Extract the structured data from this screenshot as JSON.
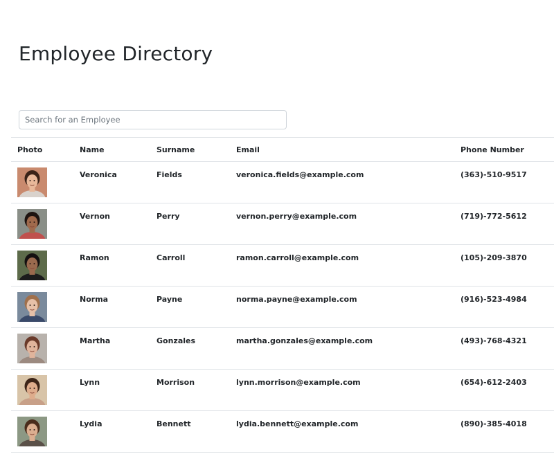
{
  "page": {
    "title": "Employee Directory"
  },
  "search": {
    "placeholder": "Search for an Employee",
    "value": ""
  },
  "table": {
    "headers": {
      "photo": "Photo",
      "name": "Name",
      "surname": "Surname",
      "email": "Email",
      "phone": "Phone Number"
    },
    "rows": [
      {
        "name": "Veronica",
        "surname": "Fields",
        "email": "veronica.fields@example.com",
        "phone": "(363)-510-9517",
        "photo": {
          "bg": "#c98a6e",
          "skin": "#e8b89a",
          "hair": "#3a2218",
          "shirt": "#d9d2cc"
        }
      },
      {
        "name": "Vernon",
        "surname": "Perry",
        "email": "vernon.perry@example.com",
        "phone": "(719)-772-5612",
        "photo": {
          "bg": "#8a8f88",
          "skin": "#a06a4c",
          "hair": "#1e1410",
          "shirt": "#c0504d"
        }
      },
      {
        "name": "Ramon",
        "surname": "Carroll",
        "email": "ramon.carroll@example.com",
        "phone": "(105)-209-3870",
        "photo": {
          "bg": "#5d6b4a",
          "skin": "#9a6a4e",
          "hair": "#141010",
          "shirt": "#1c1c1c"
        }
      },
      {
        "name": "Norma",
        "surname": "Payne",
        "email": "norma.payne@example.com",
        "phone": "(916)-523-4984",
        "photo": {
          "bg": "#7a8a9c",
          "skin": "#e6c0a8",
          "hair": "#a0704c",
          "shirt": "#3a4a6a"
        }
      },
      {
        "name": "Martha",
        "surname": "Gonzales",
        "email": "martha.gonzales@example.com",
        "phone": "(493)-768-4321",
        "photo": {
          "bg": "#b8b2ac",
          "skin": "#e0b49c",
          "hair": "#6a3a2a",
          "shirt": "#9c8a80"
        }
      },
      {
        "name": "Lynn",
        "surname": "Morrison",
        "email": "lynn.morrison@example.com",
        "phone": "(654)-612-2403",
        "photo": {
          "bg": "#d8c4a8",
          "skin": "#deac8c",
          "hair": "#3c2418",
          "shirt": "#c8a088"
        }
      },
      {
        "name": "Lydia",
        "surname": "Bennett",
        "email": "lydia.bennett@example.com",
        "phone": "(890)-385-4018",
        "photo": {
          "bg": "#8c9884",
          "skin": "#dcae90",
          "hair": "#4a2c1c",
          "shirt": "#5a5048"
        }
      }
    ]
  }
}
